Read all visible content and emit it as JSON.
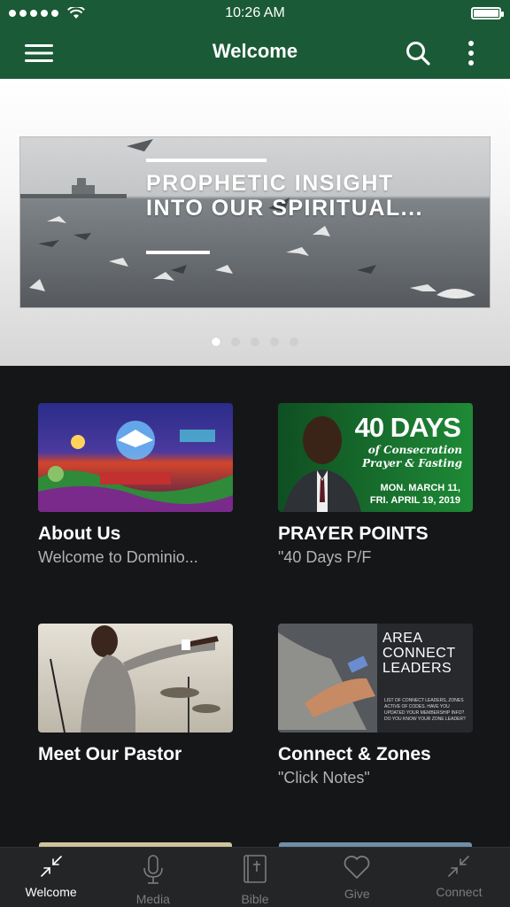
{
  "status": {
    "time": "10:26 AM"
  },
  "header": {
    "title": "Welcome",
    "menu_icon": "hamburger-menu-icon",
    "search_icon": "search-icon",
    "more_icon": "more-vertical-icon",
    "bar_color": "#1b5a36"
  },
  "hero": {
    "banner_title": "PROPHETIC INSIGHT INTO OUR SPIRITUAL...",
    "page_count": 5,
    "active_page": 1
  },
  "cards": [
    {
      "title": "About Us",
      "subtitle": "Welcome to Dominio..."
    },
    {
      "title": "PRAYER POINTS",
      "subtitle": "\"40 Days P/F",
      "thumb": {
        "big": "40 DAYS",
        "script_1": "of Consecration",
        "script_2": "Prayer & Fasting",
        "date_1": "MON. MARCH 11,",
        "date_2": "FRI. APRIL 19, 2019"
      }
    },
    {
      "title": "Meet Our Pastor",
      "subtitle": ""
    },
    {
      "title": "Connect & Zones",
      "subtitle": "\"Click Notes\"",
      "thumb": {
        "line_1": "AREA",
        "line_2": "CONNECT",
        "line_3": "LEADERS",
        "small": "LIST OF CONNECT LEADERS, ZONES ACTIVE OF CODES. HAVE YOU UPDATED YOUR MEMBERSHIP INFO? DO YOU KNOW YOUR ZONE LEADER?"
      }
    }
  ],
  "tabs": [
    {
      "label": "Welcome",
      "icon": "collapse-arrows-icon",
      "active": true
    },
    {
      "label": "Media",
      "icon": "microphone-icon",
      "active": false
    },
    {
      "label": "Bible",
      "icon": "bible-icon",
      "active": false
    },
    {
      "label": "Give",
      "icon": "heart-icon",
      "active": false
    },
    {
      "label": "Connect",
      "icon": "collapse-arrows-icon",
      "active": false
    }
  ]
}
